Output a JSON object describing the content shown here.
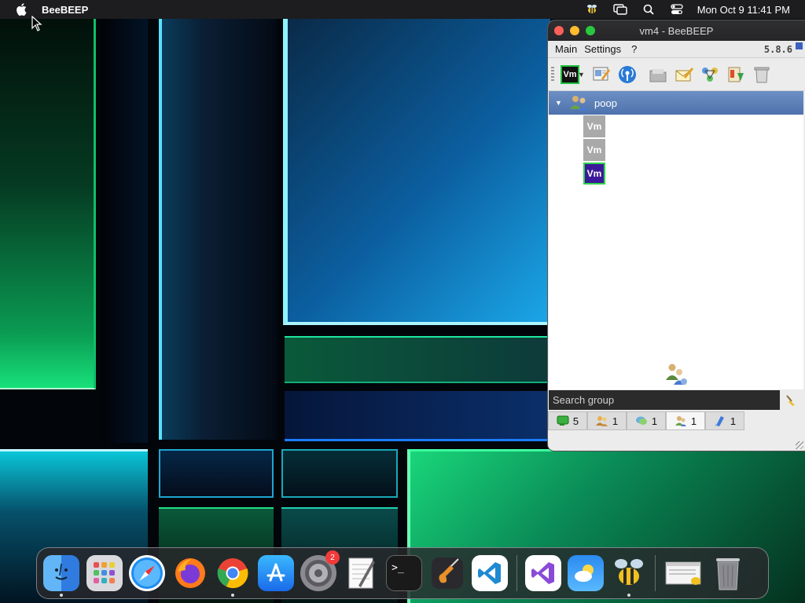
{
  "menubar": {
    "app_name": "BeeBEEP",
    "datetime": "Mon Oct 9  11:41 PM",
    "icons": [
      "bee-status-icon",
      "screen-mirror-icon",
      "spotlight-search-icon",
      "control-center-icon"
    ]
  },
  "window": {
    "title": "vm4 - BeeBEEP",
    "version": "5.8.6",
    "menu": [
      "Main",
      "Settings",
      "?"
    ],
    "toolbar": {
      "user_label": "Vm",
      "icons": [
        "status-icon",
        "edit-profile-icon",
        "broadcast-icon",
        "open-folder-icon",
        "write-message-icon",
        "network-icon",
        "file-transfer-icon",
        "trash-icon"
      ]
    },
    "group": {
      "name": "poop"
    },
    "users": [
      {
        "label": "Vm",
        "status": "offline"
      },
      {
        "label": "Vm",
        "status": "offline"
      },
      {
        "label": "Vm",
        "status": "online"
      }
    ],
    "search": {
      "placeholder": "Search group"
    },
    "tabs": [
      {
        "icon": "users-online-icon",
        "count": "5"
      },
      {
        "icon": "users-icon",
        "count": "1"
      },
      {
        "icon": "chats-icon",
        "count": "1"
      },
      {
        "icon": "groups-icon",
        "count": "1"
      },
      {
        "icon": "files-icon",
        "count": "1"
      }
    ],
    "selected_tab_index": 3
  },
  "dock": {
    "apps": [
      {
        "name": "Finder",
        "running": true
      },
      {
        "name": "Launchpad",
        "running": false
      },
      {
        "name": "Safari",
        "running": false
      },
      {
        "name": "Firefox",
        "running": false
      },
      {
        "name": "Chrome",
        "running": true
      },
      {
        "name": "App Store",
        "running": false
      },
      {
        "name": "System Settings",
        "running": false,
        "badge": "2"
      },
      {
        "name": "TextEdit",
        "running": false
      },
      {
        "name": "Terminal",
        "running": false
      },
      {
        "name": "GarageBand",
        "running": false
      },
      {
        "name": "Visual Studio Code",
        "running": false
      },
      {
        "name": "Visual Studio",
        "running": false
      },
      {
        "name": "Weather",
        "running": false
      },
      {
        "name": "BeeBEEP",
        "running": true
      },
      {
        "name": "BeeBEEP Window",
        "running": false
      },
      {
        "name": "Trash",
        "running": false
      }
    ]
  },
  "colors": {
    "menubar_bg": "#1d1d1f",
    "group_row": "#5a7cb6",
    "online_border": "#2ed34a",
    "online_fill": "#3b1a9a",
    "offline_fill": "#a9a9a9",
    "badge": "#f03a3a"
  }
}
